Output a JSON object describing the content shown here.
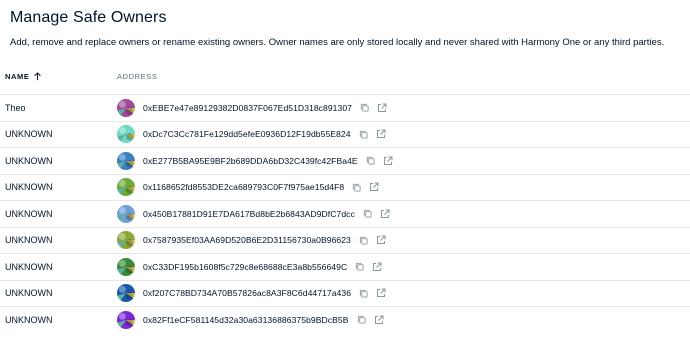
{
  "header": {
    "title": "Manage Safe Owners",
    "description": "Add, remove and replace owners or rename existing owners. Owner names are only stored locally and never shared with Harmony One or any third parties."
  },
  "table": {
    "columns": {
      "name": "NAME",
      "address": "ADDRESS"
    },
    "rows": [
      {
        "name": "Theo",
        "address": "0xEBE7e47e89129382D0837F067Ed51D318c891307",
        "avatar_color": "#a04a9a"
      },
      {
        "name": "UNKNOWN",
        "address": "0xDc7C3Cc781Fe129dd5efeE0936D12F19db55E824",
        "avatar_color": "#6ed9c0"
      },
      {
        "name": "UNKNOWN",
        "address": "0xE277B5BA95E9BF2b689DDA6bD32C439fc42FBa4E",
        "avatar_color": "#3a7fc0"
      },
      {
        "name": "UNKNOWN",
        "address": "0x1168652fd8553DE2ca689793C0F7f975ae15d4F8",
        "avatar_color": "#6aaa3a"
      },
      {
        "name": "UNKNOWN",
        "address": "0x450B17881D91E7DA617Bd8bE2b6843AD9DfC7dcc",
        "avatar_color": "#6f9fd8"
      },
      {
        "name": "UNKNOWN",
        "address": "0x7587935Ef03AA69D520B6E2D31156730a0B96623",
        "avatar_color": "#8aa83a"
      },
      {
        "name": "UNKNOWN",
        "address": "0xC33DF195b1608f5c729c8e68688cE3a8b556649C",
        "avatar_color": "#3a8a3a"
      },
      {
        "name": "UNKNOWN",
        "address": "0xf207C78BD734A70B57826ac8A3F8C6d44717a436",
        "avatar_color": "#1a5aa8"
      },
      {
        "name": "UNKNOWN",
        "address": "0x82Ff1eCF581145d32a30a63136886375b9BDcB5B",
        "avatar_color": "#7a2ad0"
      }
    ]
  },
  "icons": {
    "sort": "arrow-up-icon",
    "copy": "copy-icon",
    "external": "external-link-icon"
  },
  "colors": {
    "text": "#001428",
    "muted": "#5d6d74",
    "divider": "#e8e7e6",
    "icon": "#8a9aa0"
  }
}
